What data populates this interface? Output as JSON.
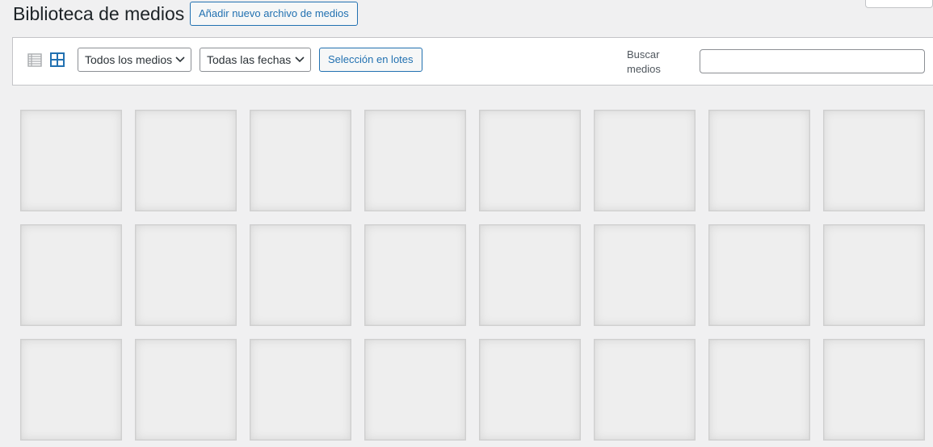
{
  "header": {
    "title": "Biblioteca de medios",
    "add_new_label": "Añadir nuevo archivo de medios"
  },
  "toolbar": {
    "view_modes": [
      {
        "name": "list",
        "icon": "list-view-icon",
        "active": false
      },
      {
        "name": "grid",
        "icon": "grid-view-icon",
        "active": true
      }
    ],
    "media_type_filter": {
      "selected": "Todos los medios"
    },
    "date_filter": {
      "selected": "Todas las fechas"
    },
    "bulk_select_label": "Selección en lotes",
    "search": {
      "label": "Buscar medios",
      "value": "",
      "placeholder": ""
    }
  },
  "media_grid": {
    "rows": 3,
    "columns": 8,
    "items_visible": 24
  },
  "colors": {
    "accent": "#2271b1",
    "background": "#f0f0f1",
    "panel": "#ffffff",
    "border": "#c3c4c7",
    "tile": "#eeeeee"
  }
}
